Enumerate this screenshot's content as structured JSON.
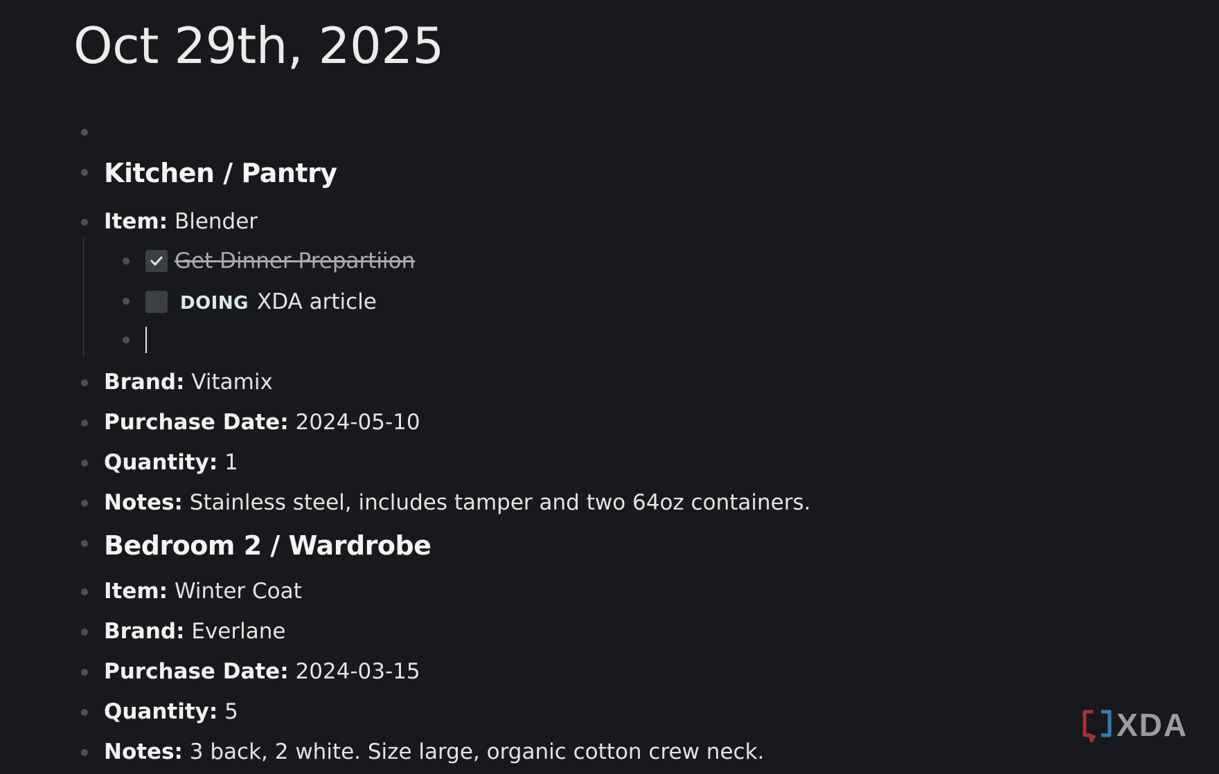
{
  "page": {
    "title": "Oct 29th, 2025"
  },
  "blocks": {
    "kitchen_heading": "Kitchen / Pantry",
    "kitchen_item": {
      "label": "Item:",
      "value": "Blender"
    },
    "todo_done": {
      "text": "Get Dinner Prepartiion",
      "checked": true
    },
    "todo_doing": {
      "marker": "DOING",
      "text": "XDA article",
      "checked": false
    },
    "kitchen_brand": {
      "label": "Brand:",
      "value": "Vitamix"
    },
    "kitchen_purchase_date": {
      "label": "Purchase Date:",
      "value": "2024-05-10"
    },
    "kitchen_quantity": {
      "label": "Quantity:",
      "value": "1"
    },
    "kitchen_notes": {
      "label": "Notes:",
      "value": "Stainless steel, includes tamper and two 64oz containers."
    },
    "bedroom_heading": "Bedroom 2 / Wardrobe",
    "bedroom_item": {
      "label": "Item:",
      "value": "Winter Coat"
    },
    "bedroom_brand": {
      "label": "Brand:",
      "value": "Everlane"
    },
    "bedroom_purchase_date": {
      "label": "Purchase Date:",
      "value": "2024-03-15"
    },
    "bedroom_quantity": {
      "label": "Quantity:",
      "value": "5"
    },
    "bedroom_notes": {
      "label": "Notes:",
      "value": "3 back, 2 white. Size large, organic cotton crew neck."
    }
  },
  "watermark": {
    "text": "XDA"
  },
  "colors": {
    "background": "#18191c",
    "bullet": "#4c4f55",
    "checkbox": "#3c3f44",
    "text": "#e4e4e4",
    "doing_marker": "#dde9f0",
    "logo_red": "#a8323c",
    "logo_blue": "#2f7fb5"
  },
  "icons": {
    "checkmark": "check-icon",
    "logo": "xda-logo-icon"
  }
}
